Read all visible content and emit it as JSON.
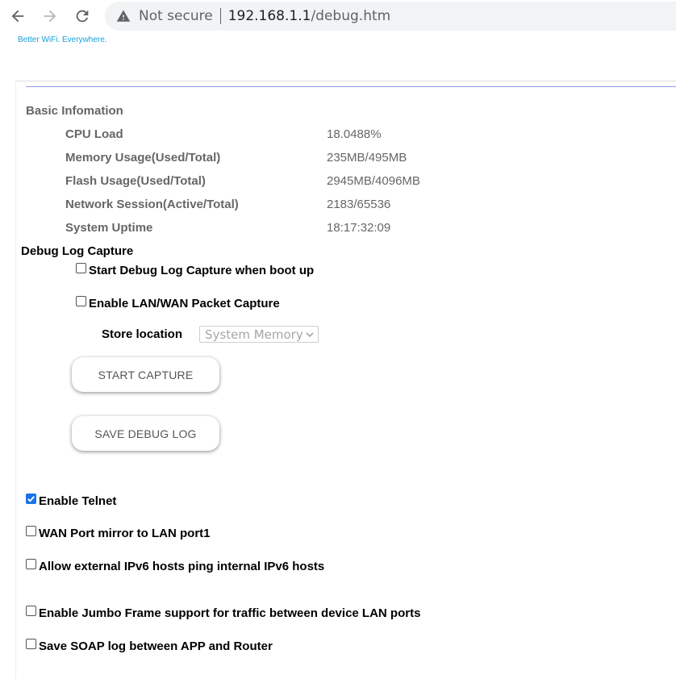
{
  "browser": {
    "security_label": "Not secure",
    "url_host": "192.168.1.1",
    "url_path": "/debug.htm"
  },
  "brand": {
    "tagline": "Better WiFi. Everywhere."
  },
  "basic_info": {
    "title": "Basic Infomation",
    "rows": [
      {
        "label": "CPU Load",
        "value": "18.0488%"
      },
      {
        "label": "Memory Usage(Used/Total)",
        "value": "235MB/495MB"
      },
      {
        "label": "Flash Usage(Used/Total)",
        "value": "2945MB/4096MB"
      },
      {
        "label": "Network Session(Active/Total)",
        "value": "2183/65536"
      },
      {
        "label": "System Uptime",
        "value": "18:17:32:09"
      }
    ]
  },
  "debug_log": {
    "title": "Debug Log Capture",
    "start_on_boot": {
      "label": "Start Debug Log Capture when boot up",
      "checked": false
    },
    "packet_capture": {
      "label": "Enable LAN/WAN Packet Capture",
      "checked": false
    },
    "store_location_label": "Store location",
    "store_location_value": "System Memory",
    "start_capture_label": "START CAPTURE",
    "save_log_label": "SAVE DEBUG LOG"
  },
  "options": [
    {
      "label": "Enable Telnet",
      "checked": true
    },
    {
      "label": "WAN Port mirror to LAN port1",
      "checked": false
    },
    {
      "label": "Allow external IPv6 hosts ping internal IPv6 hosts",
      "checked": false
    },
    {
      "label": "Enable Jumbo Frame support for traffic between device LAN ports",
      "checked": false
    },
    {
      "label": "Save SOAP log between APP and Router",
      "checked": false
    }
  ],
  "colors": {
    "checkbox_checked": "#1a73e8",
    "tagline": "#1aa0e0",
    "divider": "#8f98e8"
  }
}
